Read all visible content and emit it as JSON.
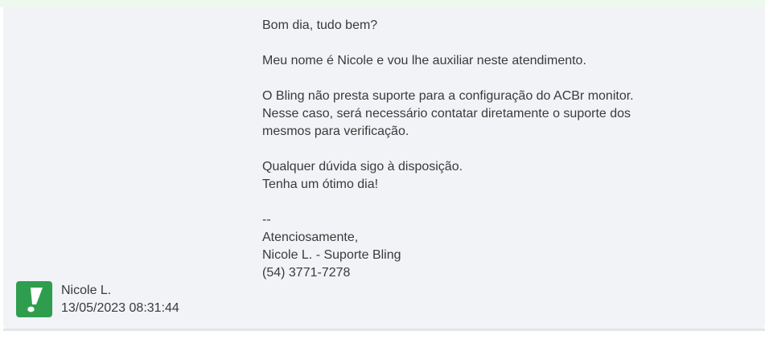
{
  "message": {
    "greeting": "Bom dia, tudo bem?",
    "intro": "Meu nome é Nicole e vou lhe auxiliar neste atendimento.",
    "body_line1": "O Bling não presta suporte para a configuração do ACBr monitor.",
    "body_line2": "Nesse caso, será necessário contatar diretamente o suporte dos",
    "body_line3": "mesmos para verificação.",
    "closing_line1": "Qualquer dúvida sigo à disposição.",
    "closing_line2": "Tenha um ótimo dia!",
    "signature_sep": "--",
    "signature_regards": "Atenciosamente,",
    "signature_name": "Nicole L. - Suporte Bling",
    "signature_phone": "(54) 3771-7278"
  },
  "author": {
    "name": "Nicole L.",
    "timestamp": "13/05/2023 08:31:44",
    "avatar_icon": "exclamation-logo-icon",
    "avatar_color": "#2e9e4e"
  }
}
